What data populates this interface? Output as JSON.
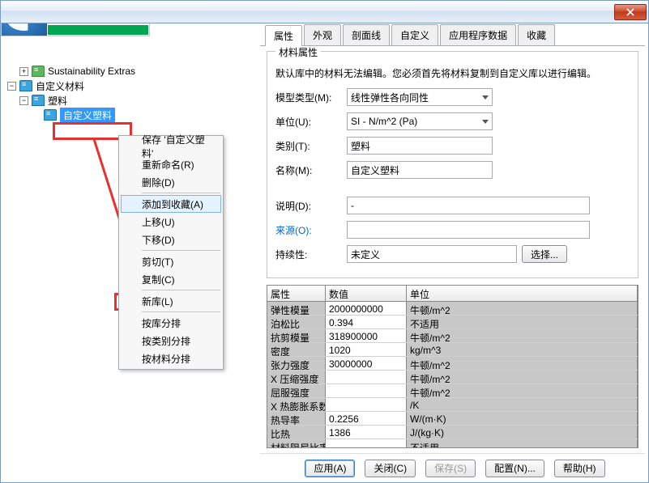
{
  "tree": {
    "n1": "Sustainability Extras",
    "n2": "自定义材料",
    "n3": "塑料",
    "n4": "自定义塑料"
  },
  "ctx": {
    "save": "保存 '自定义塑料'",
    "rename": "重新命名(R)",
    "delete": "删除(D)",
    "fav": "添加到收藏(A)",
    "up": "上移(U)",
    "down": "下移(D)",
    "cut": "剪切(T)",
    "copy": "复制(C)",
    "newlib": "新库(L)",
    "sortlib": "按库分排",
    "sortcat": "按类别分排",
    "sortmat": "按材料分排"
  },
  "tabs": {
    "t1": "属性",
    "t2": "外观",
    "t3": "剖面线",
    "t4": "自定义",
    "t5": "应用程序数据",
    "t6": "收藏"
  },
  "props": {
    "group": "材料属性",
    "note": "默认库中的材料无法编辑。您必须首先将材料复制到自定义库以进行编辑。",
    "model_l": "模型类型(M):",
    "model_v": "线性弹性各向同性",
    "unit_l": "单位(U):",
    "unit_v": "SI - N/m^2 (Pa)",
    "cat_l": "类别(T):",
    "cat_v": "塑料",
    "name_l": "名称(M):",
    "name_v": "自定义塑料",
    "desc_l": "说明(D):",
    "desc_v": "-",
    "src_l": "来源(O):",
    "src_v": "",
    "sus_l": "持续性:",
    "sus_v": "未定义",
    "select": "选择..."
  },
  "table": {
    "h1": "属性",
    "h2": "数值",
    "h3": "单位",
    "rows": [
      {
        "p": "弹性模量",
        "v": "2000000000",
        "u": "牛顿/m^2"
      },
      {
        "p": "泊松比",
        "v": "0.394",
        "u": "不适用"
      },
      {
        "p": "抗剪模量",
        "v": "318900000",
        "u": "牛顿/m^2"
      },
      {
        "p": "密度",
        "v": "1020",
        "u": "kg/m^3"
      },
      {
        "p": "张力强度",
        "v": "30000000",
        "u": "牛顿/m^2"
      },
      {
        "p": "X 压缩强度",
        "v": "",
        "u": "牛顿/m^2"
      },
      {
        "p": "屈服强度",
        "v": "",
        "u": "牛顿/m^2"
      },
      {
        "p": "X 热膨胀系数",
        "v": "",
        "u": "/K"
      },
      {
        "p": "热导率",
        "v": "0.2256",
        "u": "W/(m·K)"
      },
      {
        "p": "比热",
        "v": "1386",
        "u": "J/(kg·K)"
      },
      {
        "p": "材料阻尼比率",
        "v": "",
        "u": "不适用"
      }
    ]
  },
  "buttons": {
    "apply": "应用(A)",
    "close": "关闭(C)",
    "save": "保存(S)",
    "config": "配置(N)...",
    "help": "帮助(H)"
  }
}
